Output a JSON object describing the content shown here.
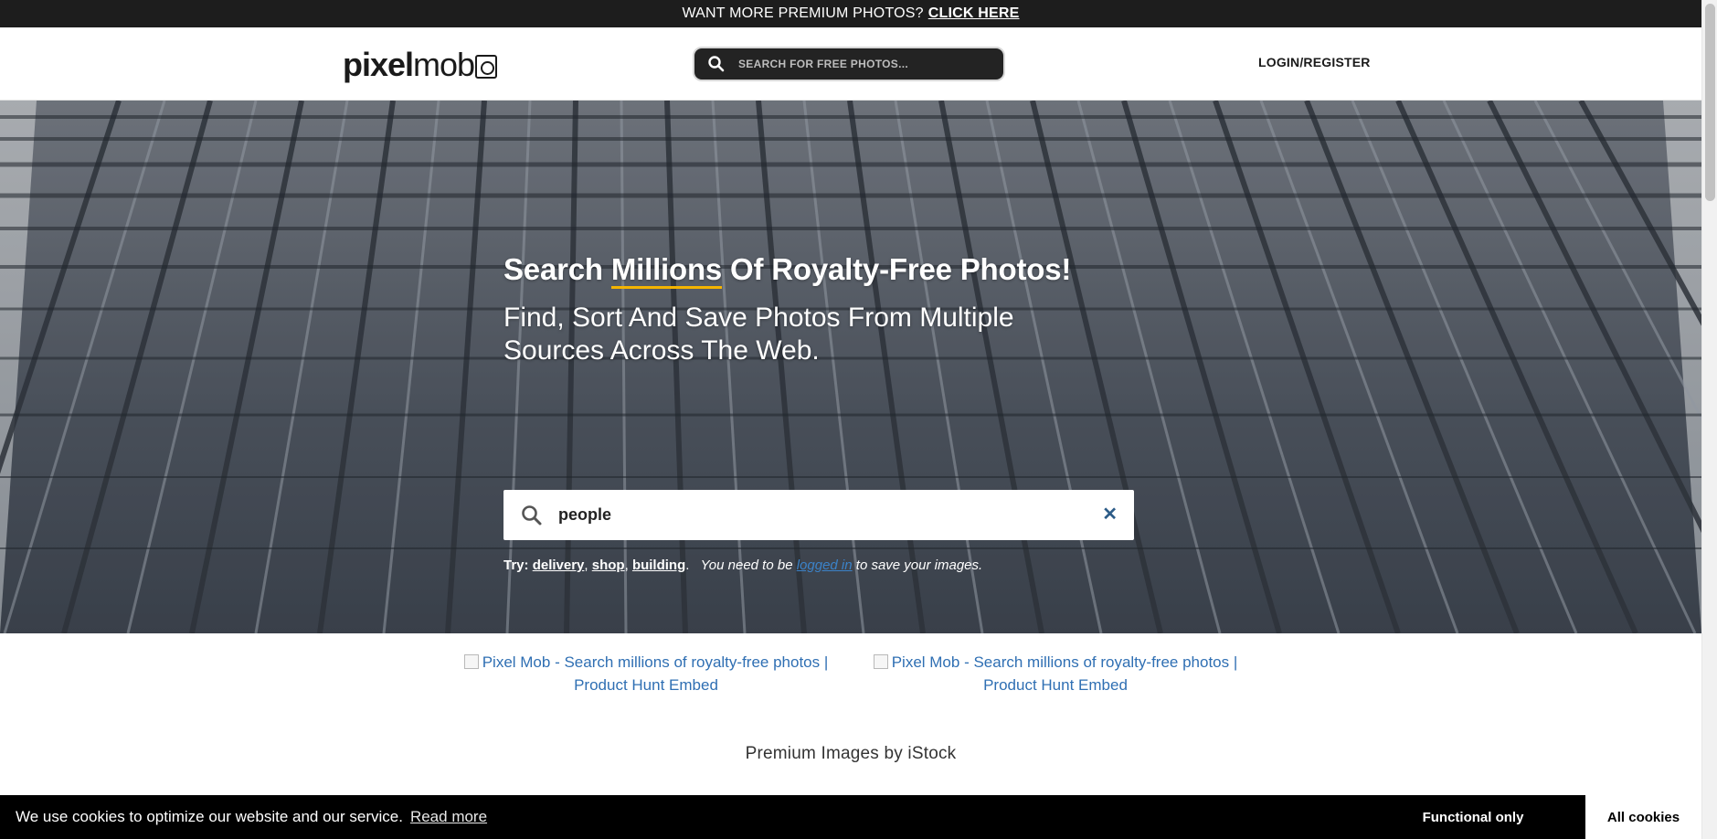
{
  "promo": {
    "text": "WANT MORE PREMIUM PHOTOS?",
    "link": "CLICK HERE"
  },
  "header": {
    "logo_part1": "pixel",
    "logo_part2": "mob",
    "search_placeholder": "SEARCH FOR FREE PHOTOS...",
    "login": "LOGIN/REGISTER"
  },
  "hero": {
    "title_pre": "Search",
    "title_highlight": "Millions",
    "title_post": "Of Royalty-Free Photos!",
    "subtitle": "Find, Sort And Save Photos From Multiple Sources Across The Web.",
    "search_value": "people",
    "clear_symbol": "✕",
    "try_label": "Try:",
    "suggestions": [
      "delivery",
      "shop",
      "building"
    ],
    "note_pre": "You need to be",
    "note_link": "logged in",
    "note_post": "to save your images."
  },
  "product_hunt": {
    "embed_1": "Pixel Mob - Search millions of royalty-free photos | Product Hunt Embed",
    "embed_2": "Pixel Mob - Search millions of royalty-free photos | Product Hunt Embed"
  },
  "premium": {
    "title": "Premium Images by iStock"
  },
  "cookie": {
    "message": "We use cookies to optimize our website and our service.",
    "read_more": "Read more",
    "functional": "Functional only",
    "all": "All cookies"
  },
  "colors": {
    "accent": "#f4b400",
    "link": "#2f6fb3",
    "dark": "#1d1d1d"
  },
  "icons": [
    "search-icon",
    "close-icon",
    "camera-logo-icon"
  ]
}
